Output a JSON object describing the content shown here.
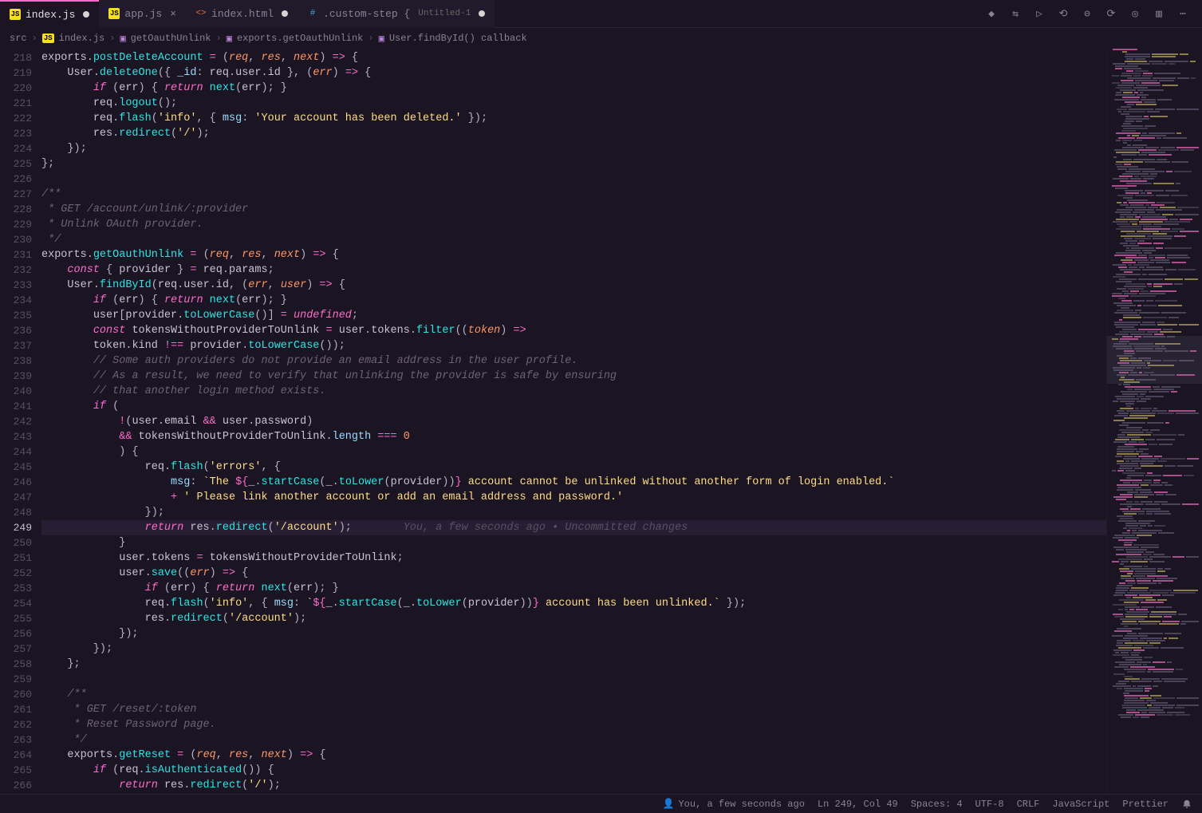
{
  "tabs": [
    {
      "label": "index.js",
      "icon": "JS",
      "modified": true,
      "active": true
    },
    {
      "label": "app.js",
      "icon": "JS",
      "modified": false,
      "active": false
    },
    {
      "label": "index.html",
      "icon": "<>",
      "modified": true,
      "active": false
    },
    {
      "label": ".custom-step {",
      "sub": "Untitled-1",
      "icon": "#",
      "modified": true,
      "active": false
    }
  ],
  "breadcrumb": {
    "parts": [
      "src",
      "index.js",
      "getOauthUnlink",
      "exports.getOauthUnlink",
      "User.findById() callback"
    ],
    "file_icon": "JS"
  },
  "first_line": 218,
  "current_line": 249,
  "blame": "You, a few seconds ago • Uncommitted changes",
  "code_lines": [
    [
      [
        "t-id",
        "exports"
      ],
      [
        "t-punc",
        "."
      ],
      [
        "t-func",
        "postDeleteAccount"
      ],
      [
        "t-punc",
        " "
      ],
      [
        "t-op",
        "="
      ],
      [
        "t-punc",
        " ("
      ],
      [
        "t-param",
        "req"
      ],
      [
        "t-punc",
        ", "
      ],
      [
        "t-param",
        "res"
      ],
      [
        "t-punc",
        ", "
      ],
      [
        "t-param",
        "next"
      ],
      [
        "t-punc",
        ") "
      ],
      [
        "t-op",
        "=>"
      ],
      [
        "t-punc",
        " {"
      ]
    ],
    [
      [
        "t-punc",
        "    "
      ],
      [
        "t-id",
        "User"
      ],
      [
        "t-punc",
        "."
      ],
      [
        "t-func",
        "deleteOne"
      ],
      [
        "t-punc",
        "({ "
      ],
      [
        "t-prop",
        "_id"
      ],
      [
        "t-punc",
        ": "
      ],
      [
        "t-id",
        "req"
      ],
      [
        "t-punc",
        "."
      ],
      [
        "t-id",
        "user"
      ],
      [
        "t-punc",
        "."
      ],
      [
        "t-id",
        "id"
      ],
      [
        "t-punc",
        " }, ("
      ],
      [
        "t-param",
        "err"
      ],
      [
        "t-punc",
        ") "
      ],
      [
        "t-op",
        "=>"
      ],
      [
        "t-punc",
        " {"
      ]
    ],
    [
      [
        "t-punc",
        "        "
      ],
      [
        "t-key",
        "if"
      ],
      [
        "t-punc",
        " ("
      ],
      [
        "t-id",
        "err"
      ],
      [
        "t-punc",
        ") { "
      ],
      [
        "t-key",
        "return"
      ],
      [
        "t-punc",
        " "
      ],
      [
        "t-func",
        "next"
      ],
      [
        "t-punc",
        "("
      ],
      [
        "t-id",
        "err"
      ],
      [
        "t-punc",
        "); }"
      ]
    ],
    [
      [
        "t-punc",
        "        "
      ],
      [
        "t-id",
        "req"
      ],
      [
        "t-punc",
        "."
      ],
      [
        "t-func",
        "logout"
      ],
      [
        "t-punc",
        "();"
      ]
    ],
    [
      [
        "t-punc",
        "        "
      ],
      [
        "t-id",
        "req"
      ],
      [
        "t-punc",
        "."
      ],
      [
        "t-func",
        "flash"
      ],
      [
        "t-punc",
        "("
      ],
      [
        "t-str",
        "'info'"
      ],
      [
        "t-punc",
        ", { "
      ],
      [
        "t-prop",
        "msg"
      ],
      [
        "t-punc",
        ": "
      ],
      [
        "t-str",
        "'Your account has been deleted.'"
      ],
      [
        "t-punc",
        " });"
      ]
    ],
    [
      [
        "t-punc",
        "        "
      ],
      [
        "t-id",
        "res"
      ],
      [
        "t-punc",
        "."
      ],
      [
        "t-func",
        "redirect"
      ],
      [
        "t-punc",
        "("
      ],
      [
        "t-str",
        "'/'"
      ],
      [
        "t-punc",
        ");"
      ]
    ],
    [
      [
        "t-punc",
        "    });"
      ]
    ],
    [
      [
        "t-punc",
        "};"
      ]
    ],
    [],
    [
      [
        "t-comm",
        "/**"
      ]
    ],
    [
      [
        "t-comm",
        " * GET /account/unlink/:provider"
      ]
    ],
    [
      [
        "t-comm",
        " * Unlink OAuth provider."
      ]
    ],
    [
      [
        "t-comm",
        " */"
      ]
    ],
    [
      [
        "t-id",
        "exports"
      ],
      [
        "t-punc",
        "."
      ],
      [
        "t-func",
        "getOauthUnlink"
      ],
      [
        "t-punc",
        " "
      ],
      [
        "t-op",
        "="
      ],
      [
        "t-punc",
        " ("
      ],
      [
        "t-param",
        "req"
      ],
      [
        "t-punc",
        ", "
      ],
      [
        "t-param",
        "res"
      ],
      [
        "t-punc",
        ", "
      ],
      [
        "t-param",
        "next"
      ],
      [
        "t-punc",
        ") "
      ],
      [
        "t-op",
        "=>"
      ],
      [
        "t-punc",
        " {"
      ]
    ],
    [
      [
        "t-punc",
        "    "
      ],
      [
        "t-const",
        "const"
      ],
      [
        "t-punc",
        " { "
      ],
      [
        "t-id",
        "provider"
      ],
      [
        "t-punc",
        " } "
      ],
      [
        "t-op",
        "="
      ],
      [
        "t-punc",
        " "
      ],
      [
        "t-id",
        "req"
      ],
      [
        "t-punc",
        "."
      ],
      [
        "t-id",
        "params"
      ],
      [
        "t-punc",
        ";"
      ]
    ],
    [
      [
        "t-punc",
        "    "
      ],
      [
        "t-id",
        "User"
      ],
      [
        "t-punc",
        "."
      ],
      [
        "t-func",
        "findById"
      ],
      [
        "t-punc",
        "("
      ],
      [
        "t-id",
        "req"
      ],
      [
        "t-punc",
        "."
      ],
      [
        "t-id",
        "user"
      ],
      [
        "t-punc",
        "."
      ],
      [
        "t-id",
        "id"
      ],
      [
        "t-punc",
        ", ("
      ],
      [
        "t-param",
        "err"
      ],
      [
        "t-punc",
        ", "
      ],
      [
        "t-param",
        "user"
      ],
      [
        "t-punc",
        ") "
      ],
      [
        "t-op",
        "=>"
      ],
      [
        "t-punc",
        " {"
      ]
    ],
    [
      [
        "t-punc",
        "        "
      ],
      [
        "t-key",
        "if"
      ],
      [
        "t-punc",
        " ("
      ],
      [
        "t-id",
        "err"
      ],
      [
        "t-punc",
        ") { "
      ],
      [
        "t-key",
        "return"
      ],
      [
        "t-punc",
        " "
      ],
      [
        "t-func",
        "next"
      ],
      [
        "t-punc",
        "("
      ],
      [
        "t-id",
        "err"
      ],
      [
        "t-punc",
        "); }"
      ]
    ],
    [
      [
        "t-punc",
        "        "
      ],
      [
        "t-id",
        "user"
      ],
      [
        "t-punc",
        "["
      ],
      [
        "t-id",
        "provider"
      ],
      [
        "t-punc",
        "."
      ],
      [
        "t-func",
        "toLowerCase"
      ],
      [
        "t-punc",
        "()] "
      ],
      [
        "t-op",
        "="
      ],
      [
        "t-punc",
        " "
      ],
      [
        "t-const",
        "undefined"
      ],
      [
        "t-punc",
        ";"
      ]
    ],
    [
      [
        "t-punc",
        "        "
      ],
      [
        "t-const",
        "const"
      ],
      [
        "t-punc",
        " "
      ],
      [
        "t-id",
        "tokensWithoutProviderToUnlink"
      ],
      [
        "t-punc",
        " "
      ],
      [
        "t-op",
        "="
      ],
      [
        "t-punc",
        " "
      ],
      [
        "t-id",
        "user"
      ],
      [
        "t-punc",
        "."
      ],
      [
        "t-id",
        "tokens"
      ],
      [
        "t-punc",
        "."
      ],
      [
        "t-func",
        "filter"
      ],
      [
        "t-punc",
        "(("
      ],
      [
        "t-param",
        "token"
      ],
      [
        "t-punc",
        ") "
      ],
      [
        "t-op",
        "=>"
      ]
    ],
    [
      [
        "t-punc",
        "        "
      ],
      [
        "t-id",
        "token"
      ],
      [
        "t-punc",
        "."
      ],
      [
        "t-id",
        "kind"
      ],
      [
        "t-punc",
        " "
      ],
      [
        "t-op",
        "!=="
      ],
      [
        "t-punc",
        " "
      ],
      [
        "t-id",
        "provider"
      ],
      [
        "t-punc",
        "."
      ],
      [
        "t-func",
        "toLowerCase"
      ],
      [
        "t-punc",
        "());"
      ]
    ],
    [
      [
        "t-punc",
        "        "
      ],
      [
        "t-comm",
        "// Some auth providers do not provide an email address in the user profile."
      ]
    ],
    [
      [
        "t-punc",
        "        "
      ],
      [
        "t-comm",
        "// As a result, we need to verify that unlinking the provider is safe by ensuring"
      ]
    ],
    [
      [
        "t-punc",
        "        "
      ],
      [
        "t-comm",
        "// that another login method exists."
      ]
    ],
    [
      [
        "t-punc",
        "        "
      ],
      [
        "t-key",
        "if"
      ],
      [
        "t-punc",
        " ("
      ]
    ],
    [
      [
        "t-punc",
        "            "
      ],
      [
        "t-op",
        "!"
      ],
      [
        "t-punc",
        "("
      ],
      [
        "t-id",
        "user"
      ],
      [
        "t-punc",
        "."
      ],
      [
        "t-id",
        "email"
      ],
      [
        "t-punc",
        " "
      ],
      [
        "t-op",
        "&&"
      ],
      [
        "t-punc",
        " "
      ],
      [
        "t-id",
        "user"
      ],
      [
        "t-punc",
        "."
      ],
      [
        "t-id",
        "password"
      ],
      [
        "t-punc",
        ")"
      ]
    ],
    [
      [
        "t-punc",
        "            "
      ],
      [
        "t-op",
        "&&"
      ],
      [
        "t-punc",
        " "
      ],
      [
        "t-id",
        "tokensWithoutProviderToUnlink"
      ],
      [
        "t-punc",
        "."
      ],
      [
        "t-prop",
        "length"
      ],
      [
        "t-punc",
        " "
      ],
      [
        "t-op",
        "==="
      ],
      [
        "t-punc",
        " "
      ],
      [
        "t-num",
        "0"
      ]
    ],
    [
      [
        "t-punc",
        "            ) "
      ],
      [
        "t-punc",
        "{"
      ]
    ],
    [
      [
        "t-punc",
        "                "
      ],
      [
        "t-id",
        "req"
      ],
      [
        "t-punc",
        "."
      ],
      [
        "t-func",
        "flash"
      ],
      [
        "t-punc",
        "("
      ],
      [
        "t-str",
        "'errors'"
      ],
      [
        "t-punc",
        ", {"
      ]
    ],
    [
      [
        "t-punc",
        "                    "
      ],
      [
        "t-prop",
        "msg"
      ],
      [
        "t-punc",
        ": "
      ],
      [
        "t-str",
        "`The "
      ],
      [
        "t-op",
        "${"
      ],
      [
        "t-id",
        "_"
      ],
      [
        "t-punc",
        "."
      ],
      [
        "t-func",
        "startCase"
      ],
      [
        "t-punc",
        "("
      ],
      [
        "t-id",
        "_"
      ],
      [
        "t-punc",
        "."
      ],
      [
        "t-func",
        "toLower"
      ],
      [
        "t-punc",
        "("
      ],
      [
        "t-id",
        "provider"
      ],
      [
        "t-punc",
        "))"
      ],
      [
        "t-op",
        "}"
      ],
      [
        "t-str",
        " account cannot be unlinked without another form of login enabled.`"
      ]
    ],
    [
      [
        "t-punc",
        "                    "
      ],
      [
        "t-op",
        "+"
      ],
      [
        "t-punc",
        " "
      ],
      [
        "t-str",
        "' Please link another account or add an email address and password.'"
      ]
    ],
    [
      [
        "t-punc",
        "                });"
      ]
    ],
    [
      [
        "t-punc",
        "                "
      ],
      [
        "t-key",
        "return"
      ],
      [
        "t-punc",
        " "
      ],
      [
        "t-id",
        "res"
      ],
      [
        "t-punc",
        "."
      ],
      [
        "t-func",
        "redirect"
      ],
      [
        "t-punc",
        "("
      ],
      [
        "t-str",
        "'/account'"
      ],
      [
        "t-punc",
        ");"
      ]
    ],
    [
      [
        "t-punc",
        "            "
      ],
      [
        "t-punc",
        "}"
      ]
    ],
    [
      [
        "t-punc",
        "            "
      ],
      [
        "t-id",
        "user"
      ],
      [
        "t-punc",
        "."
      ],
      [
        "t-id",
        "tokens"
      ],
      [
        "t-punc",
        " "
      ],
      [
        "t-op",
        "="
      ],
      [
        "t-punc",
        " "
      ],
      [
        "t-id",
        "tokensWithoutProviderToUnlink"
      ],
      [
        "t-punc",
        ";"
      ]
    ],
    [
      [
        "t-punc",
        "            "
      ],
      [
        "t-id",
        "user"
      ],
      [
        "t-punc",
        "."
      ],
      [
        "t-func",
        "save"
      ],
      [
        "t-punc",
        "(("
      ],
      [
        "t-param",
        "err"
      ],
      [
        "t-punc",
        ") "
      ],
      [
        "t-op",
        "=>"
      ],
      [
        "t-punc",
        " {"
      ]
    ],
    [
      [
        "t-punc",
        "                "
      ],
      [
        "t-key",
        "if"
      ],
      [
        "t-punc",
        " ("
      ],
      [
        "t-id",
        "err"
      ],
      [
        "t-punc",
        ") { "
      ],
      [
        "t-key",
        "return"
      ],
      [
        "t-punc",
        " "
      ],
      [
        "t-func",
        "next"
      ],
      [
        "t-punc",
        "("
      ],
      [
        "t-id",
        "err"
      ],
      [
        "t-punc",
        "); }"
      ]
    ],
    [
      [
        "t-punc",
        "                "
      ],
      [
        "t-id",
        "req"
      ],
      [
        "t-punc",
        "."
      ],
      [
        "t-func",
        "flash"
      ],
      [
        "t-punc",
        "("
      ],
      [
        "t-str",
        "'info'"
      ],
      [
        "t-punc",
        ", { "
      ],
      [
        "t-prop",
        "msg"
      ],
      [
        "t-punc",
        ": "
      ],
      [
        "t-str",
        "`"
      ],
      [
        "t-op",
        "${"
      ],
      [
        "t-id",
        "_"
      ],
      [
        "t-punc",
        "."
      ],
      [
        "t-func",
        "startCase"
      ],
      [
        "t-punc",
        "("
      ],
      [
        "t-id",
        "_"
      ],
      [
        "t-punc",
        "."
      ],
      [
        "t-func",
        "toLower"
      ],
      [
        "t-punc",
        "("
      ],
      [
        "t-id",
        "provider"
      ],
      [
        "t-punc",
        "))"
      ],
      [
        "t-op",
        "}"
      ],
      [
        "t-str",
        " account has been unlinked.`"
      ],
      [
        "t-punc",
        " });"
      ]
    ],
    [
      [
        "t-punc",
        "                "
      ],
      [
        "t-id",
        "res"
      ],
      [
        "t-punc",
        "."
      ],
      [
        "t-func",
        "redirect"
      ],
      [
        "t-punc",
        "("
      ],
      [
        "t-str",
        "'/account'"
      ],
      [
        "t-punc",
        ");"
      ]
    ],
    [
      [
        "t-punc",
        "            });"
      ]
    ],
    [
      [
        "t-punc",
        "        });"
      ]
    ],
    [
      [
        "t-punc",
        "    };"
      ]
    ],
    [],
    [
      [
        "t-punc",
        "    "
      ],
      [
        "t-comm",
        "/**"
      ]
    ],
    [
      [
        "t-punc",
        "    "
      ],
      [
        "t-comm",
        " * GET /reset/:token"
      ]
    ],
    [
      [
        "t-punc",
        "    "
      ],
      [
        "t-comm",
        " * Reset Password page."
      ]
    ],
    [
      [
        "t-punc",
        "    "
      ],
      [
        "t-comm",
        " */"
      ]
    ],
    [
      [
        "t-punc",
        "    "
      ],
      [
        "t-id",
        "exports"
      ],
      [
        "t-punc",
        "."
      ],
      [
        "t-func",
        "getReset"
      ],
      [
        "t-punc",
        " "
      ],
      [
        "t-op",
        "="
      ],
      [
        "t-punc",
        " ("
      ],
      [
        "t-param",
        "req"
      ],
      [
        "t-punc",
        ", "
      ],
      [
        "t-param",
        "res"
      ],
      [
        "t-punc",
        ", "
      ],
      [
        "t-param",
        "next"
      ],
      [
        "t-punc",
        ") "
      ],
      [
        "t-op",
        "=>"
      ],
      [
        "t-punc",
        " {"
      ]
    ],
    [
      [
        "t-punc",
        "        "
      ],
      [
        "t-key",
        "if"
      ],
      [
        "t-punc",
        " ("
      ],
      [
        "t-id",
        "req"
      ],
      [
        "t-punc",
        "."
      ],
      [
        "t-func",
        "isAuthenticated"
      ],
      [
        "t-punc",
        "()) {"
      ]
    ],
    [
      [
        "t-punc",
        "            "
      ],
      [
        "t-key",
        "return"
      ],
      [
        "t-punc",
        " "
      ],
      [
        "t-id",
        "res"
      ],
      [
        "t-punc",
        "."
      ],
      [
        "t-func",
        "redirect"
      ],
      [
        "t-punc",
        "("
      ],
      [
        "t-str",
        "'/'"
      ],
      [
        "t-punc",
        ");"
      ]
    ]
  ],
  "statusbar": {
    "blame": "You, a few seconds ago",
    "position": "Ln 249, Col 49",
    "spaces": "Spaces: 4",
    "encoding": "UTF-8",
    "eol": "CRLF",
    "language": "JavaScript",
    "formatter": "Prettier"
  }
}
